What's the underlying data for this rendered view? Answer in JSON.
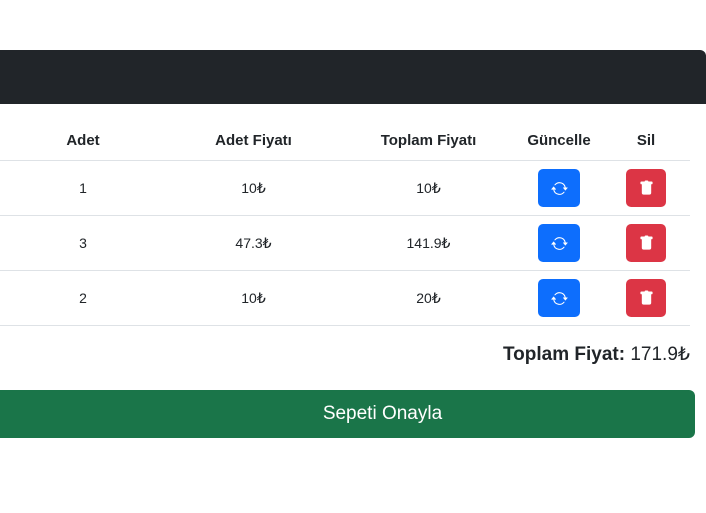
{
  "table": {
    "headers": {
      "qty": "Adet",
      "unit_price": "Adet Fiyatı",
      "total_price": "Toplam Fiyatı",
      "update": "Güncelle",
      "delete": "Sil"
    },
    "rows": [
      {
        "qty": "1",
        "unit_price": "10₺",
        "total_price": "10₺"
      },
      {
        "qty": "3",
        "unit_price": "47.3₺",
        "total_price": "141.9₺"
      },
      {
        "qty": "2",
        "unit_price": "10₺",
        "total_price": "20₺"
      }
    ]
  },
  "summary": {
    "total_label": "Toplam Fiyat:",
    "total_value": "171.9₺"
  },
  "confirm_button": "Sepeti Onayla",
  "icons": {
    "update": "refresh-icon",
    "delete": "trash-icon"
  },
  "colors": {
    "header_bar": "#212529",
    "update_button": "#0d6efd",
    "delete_button": "#dc3545",
    "confirm_button": "#1a7549"
  }
}
